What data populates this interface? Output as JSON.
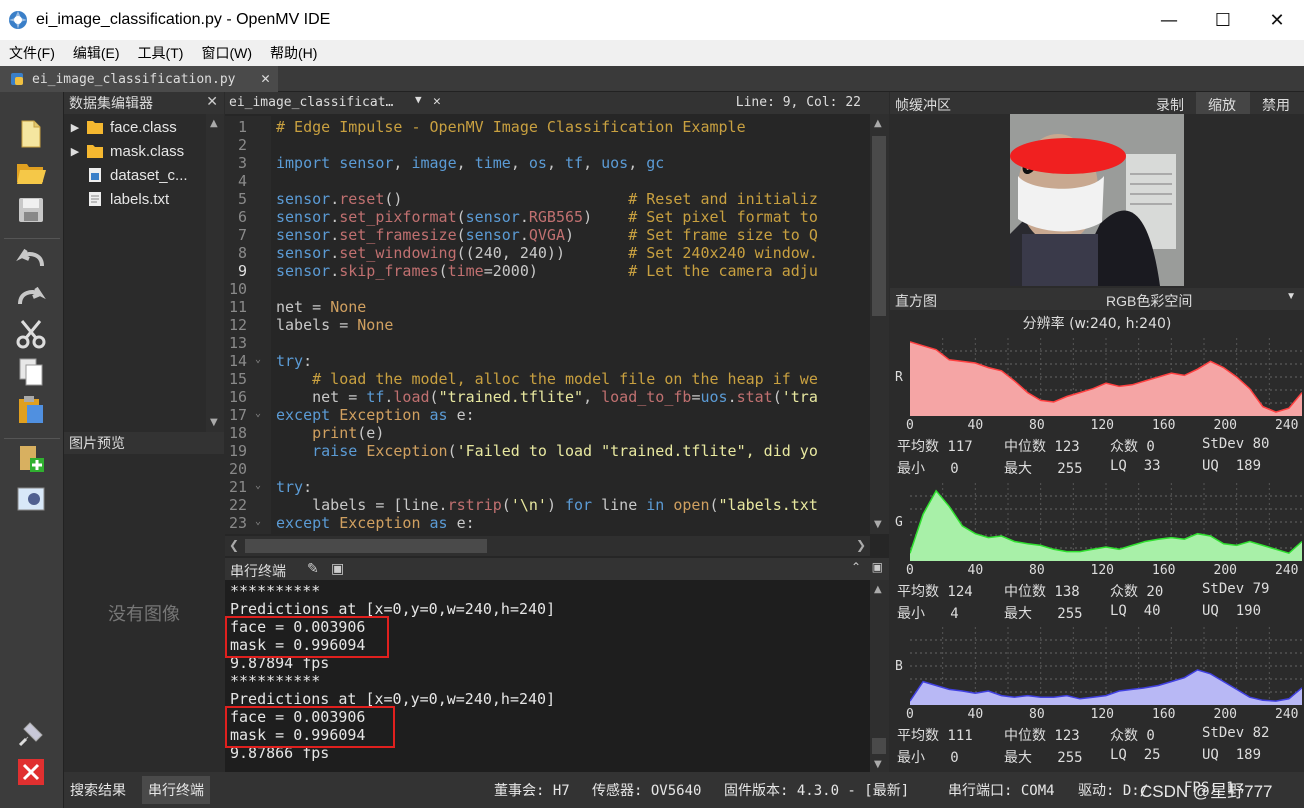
{
  "window": {
    "title": "ei_image_classification.py - OpenMV IDE"
  },
  "menu": [
    "文件(F)",
    "编辑(E)",
    "工具(T)",
    "窗口(W)",
    "帮助(H)"
  ],
  "file_tab": "ei_image_classification.py",
  "dataset_panel": {
    "title": "数据集编辑器",
    "items": [
      {
        "label": "face.class",
        "type": "folder"
      },
      {
        "label": "mask.class",
        "type": "folder"
      },
      {
        "label": "dataset_c...",
        "type": "pyfile"
      },
      {
        "label": "labels.txt",
        "type": "file"
      }
    ]
  },
  "preview_panel": {
    "title": "图片预览",
    "empty_text": "没有图像"
  },
  "editor": {
    "tab": "ei_image_classificat…",
    "position": "Line: 9, Col: 22",
    "lines": [
      {
        "n": "1",
        "html": "<span class='c'># Edge Impulse - OpenMV Image Classification Example</span>"
      },
      {
        "n": "2",
        "html": ""
      },
      {
        "n": "3",
        "html": "<span class='k'>import</span> <span class='k'>sensor</span>, <span class='k'>image</span>, <span class='k'>time</span>, <span class='k'>os</span>, <span class='k'>tf</span>, <span class='k'>uos</span>, <span class='k'>gc</span>"
      },
      {
        "n": "4",
        "html": ""
      },
      {
        "n": "5",
        "html": "<span class='k'>sensor</span>.<span class='e'>reset</span>()                         <span class='c'># Reset and initializ</span>"
      },
      {
        "n": "6",
        "html": "<span class='k'>sensor</span>.<span class='e'>set_pixformat</span>(<span class='k'>sensor</span>.<span class='e'>RGB565</span>)    <span class='c'># Set pixel format to</span>"
      },
      {
        "n": "7",
        "html": "<span class='k'>sensor</span>.<span class='e'>set_framesize</span>(<span class='k'>sensor</span>.<span class='e'>QVGA</span>)      <span class='c'># Set frame size to Q</span>"
      },
      {
        "n": "8",
        "html": "<span class='k'>sensor</span>.<span class='e'>set_windowing</span>((240, 240))       <span class='c'># Set 240x240 window.</span>"
      },
      {
        "n": "9",
        "html": "<span class='k'>sensor</span>.<span class='e'>skip_frames</span>(<span class='e'>time</span>=2000)          <span class='c'># Let the camera adju</span>"
      },
      {
        "n": "10",
        "html": ""
      },
      {
        "n": "11",
        "html": "net = <span class='f'>None</span>"
      },
      {
        "n": "12",
        "html": "labels = <span class='f'>None</span>"
      },
      {
        "n": "13",
        "html": ""
      },
      {
        "n": "14",
        "html": "<span class='k'>try</span>:"
      },
      {
        "n": "15",
        "html": "    <span class='c'># load the model, alloc the model file on the heap if we</span>"
      },
      {
        "n": "16",
        "html": "    net = <span class='k'>tf</span>.<span class='e'>load</span>(<span class='s'>\"trained.tflite\"</span>, <span class='e'>load_to_fb</span>=<span class='k'>uos</span>.<span class='e'>stat</span>(<span class='s'>'tra</span>"
      },
      {
        "n": "17",
        "html": "<span class='k'>except</span> <span class='f'>Exception</span> <span class='k'>as</span> e:"
      },
      {
        "n": "18",
        "html": "    <span class='f'>print</span>(e)"
      },
      {
        "n": "19",
        "html": "    <span class='k'>raise</span> <span class='f'>Exception</span>(<span class='s'>'Failed to load \"trained.tflite\", did yo</span>"
      },
      {
        "n": "20",
        "html": ""
      },
      {
        "n": "21",
        "html": "<span class='k'>try</span>:"
      },
      {
        "n": "22",
        "html": "    labels = [line.<span class='e'>rstrip</span>(<span class='s'>'\\n'</span>) <span class='k'>for</span> line <span class='k'>in</span> <span class='f'>open</span>(<span class='s'>\"labels.txt</span>"
      },
      {
        "n": "23",
        "html": "<span class='k'>except</span> <span class='f'>Exception</span> <span class='k'>as</span> e:"
      }
    ]
  },
  "serial": {
    "title": "串行终端",
    "lines": [
      "**********",
      "Predictions at [x=0,y=0,w=240,h=240]",
      "face = 0.003906",
      "mask = 0.996094",
      "9.87894 fps",
      "**********",
      "Predictions at [x=0,y=0,w=240,h=240]",
      "face = 0.003906",
      "mask = 0.996094",
      "9.87866 fps"
    ]
  },
  "framebuffer": {
    "title": "帧缓冲区",
    "record": "录制",
    "zoom": "缩放",
    "disable": "禁用"
  },
  "histogram": {
    "title": "直方图",
    "colorspace": "RGB色彩空间",
    "resolution": "分辨率 (w:240, h:240)",
    "ticks": [
      "0",
      "40",
      "80",
      "120",
      "160",
      "200",
      "240"
    ],
    "channels": [
      {
        "label": "R",
        "color": "#f5a5a5",
        "stroke": "#ff4040",
        "values": [
          0.95,
          0.9,
          0.85,
          0.72,
          0.7,
          0.68,
          0.62,
          0.58,
          0.45,
          0.3,
          0.2,
          0.18,
          0.25,
          0.3,
          0.35,
          0.42,
          0.38,
          0.4,
          0.45,
          0.5,
          0.55,
          0.52,
          0.6,
          0.7,
          0.62,
          0.5,
          0.35,
          0.12,
          0.05,
          0.1,
          0.3
        ],
        "stats": {
          "mean": "117",
          "median": "123",
          "mode": "0",
          "stdev": "80",
          "min": "0",
          "max": "255",
          "lq": "33",
          "uq": "189"
        }
      },
      {
        "label": "G",
        "color": "#a8f0a8",
        "stroke": "#30e030",
        "values": [
          0.1,
          0.6,
          0.9,
          0.7,
          0.45,
          0.35,
          0.3,
          0.32,
          0.25,
          0.22,
          0.2,
          0.15,
          0.12,
          0.12,
          0.15,
          0.18,
          0.15,
          0.2,
          0.25,
          0.28,
          0.3,
          0.28,
          0.35,
          0.32,
          0.22,
          0.2,
          0.25,
          0.2,
          0.15,
          0.1,
          0.25
        ],
        "stats": {
          "mean": "124",
          "median": "138",
          "mode": "20",
          "stdev": "79",
          "min": "4",
          "max": "255",
          "lq": "40",
          "uq": "190"
        }
      },
      {
        "label": "B",
        "color": "#b8b8f5",
        "stroke": "#4040e0",
        "values": [
          0.05,
          0.3,
          0.25,
          0.2,
          0.18,
          0.15,
          0.18,
          0.12,
          0.1,
          0.12,
          0.1,
          0.1,
          0.12,
          0.08,
          0.1,
          0.12,
          0.18,
          0.2,
          0.22,
          0.25,
          0.3,
          0.35,
          0.45,
          0.4,
          0.3,
          0.2,
          0.1,
          0.06,
          0.05,
          0.08,
          0.22
        ],
        "stats": {
          "mean": "111",
          "median": "123",
          "mode": "0",
          "stdev": "82",
          "min": "0",
          "max": "255",
          "lq": "25",
          "uq": "189"
        }
      }
    ],
    "labels": {
      "mean": "平均数",
      "median": "中位数",
      "mode": "众数",
      "stdev": "StDev",
      "min": "最小",
      "max": "最大",
      "lq": "LQ",
      "uq": "UQ"
    }
  },
  "bottom_tabs": [
    "搜索结果",
    "串行终端"
  ],
  "status": {
    "board": "董事会: H7",
    "sensor": "传感器: OV5640",
    "firmware": "固件版本: 4.3.0 - [最新]",
    "port": "串行端口: COM4",
    "drive": "驱动: D:/",
    "fps": "FPS: 1",
    "watermark": "CSDN @星野777"
  }
}
